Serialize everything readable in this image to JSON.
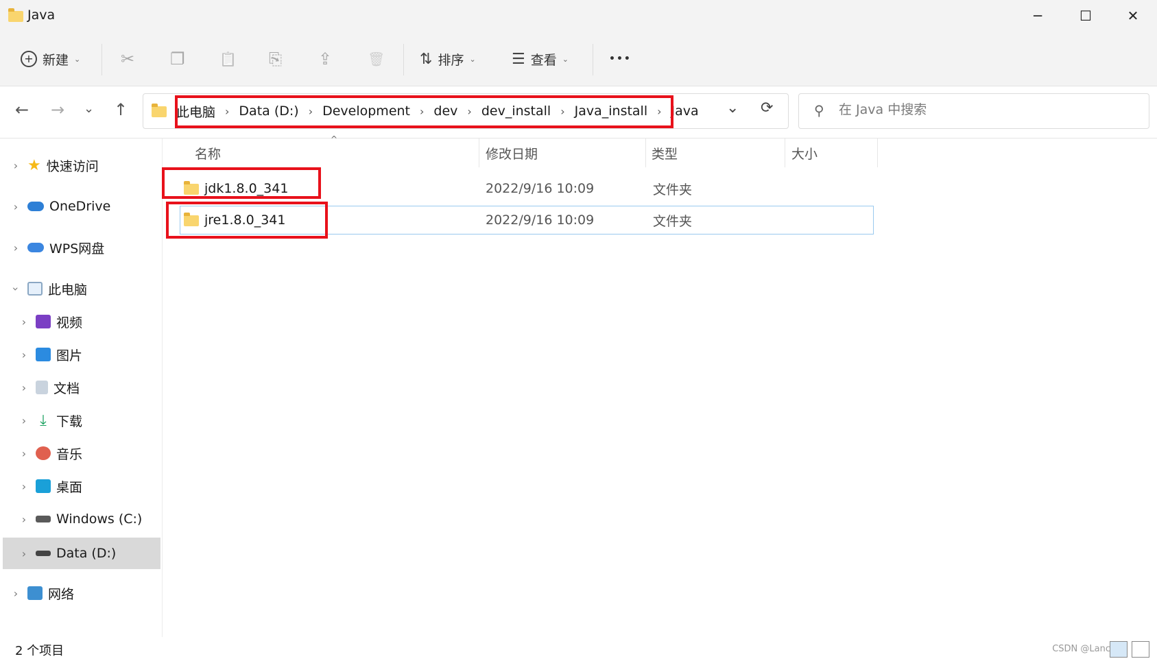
{
  "window": {
    "title": "Java",
    "minimize": "─",
    "maximize": "☐",
    "close": "✕"
  },
  "toolbar": {
    "new_label": "新建",
    "sort_label": "排序",
    "view_label": "查看",
    "more_label": "•••",
    "cut_icon": "✂",
    "copy_icon": "❐",
    "paste_icon": "📋",
    "rename_icon": "⎘",
    "share_icon": "⇪",
    "delete_icon": "🗑"
  },
  "nav": {
    "back": "←",
    "forward": "→",
    "recent": "⌄",
    "up": "↑",
    "refresh": "⟳",
    "dropdown": "⌄"
  },
  "address": {
    "crumbs": [
      "此电脑",
      "Data (D:)",
      "Development",
      "dev",
      "dev_install",
      "Java_install",
      "Java"
    ],
    "separator": "›"
  },
  "search": {
    "placeholder": "在 Java 中搜索"
  },
  "sidebar": {
    "items": [
      {
        "label": "快速访问",
        "icon": "star-icon"
      },
      {
        "label": "OneDrive",
        "icon": "cloud-icon"
      },
      {
        "label": "WPS网盘",
        "icon": "cloud-icon"
      },
      {
        "label": "此电脑",
        "icon": "computer-icon"
      },
      {
        "label": "视频",
        "icon": "video-icon"
      },
      {
        "label": "图片",
        "icon": "picture-icon"
      },
      {
        "label": "文档",
        "icon": "document-icon"
      },
      {
        "label": "下载",
        "icon": "download-icon"
      },
      {
        "label": "音乐",
        "icon": "music-icon"
      },
      {
        "label": "桌面",
        "icon": "desktop-icon"
      },
      {
        "label": "Windows (C:)",
        "icon": "drive-icon"
      },
      {
        "label": "Data (D:)",
        "icon": "drive-icon"
      },
      {
        "label": "网络",
        "icon": "network-icon"
      }
    ]
  },
  "columns": {
    "name": "名称",
    "modified": "修改日期",
    "type": "类型",
    "size": "大小"
  },
  "files": [
    {
      "name": "jdk1.8.0_341",
      "modified": "2022/9/16 10:09",
      "type": "文件夹",
      "size": ""
    },
    {
      "name": "jre1.8.0_341",
      "modified": "2022/9/16 10:09",
      "type": "文件夹",
      "size": ""
    }
  ],
  "status": {
    "count": "2 个项目",
    "watermark": "CSDN @Lance"
  },
  "colors": {
    "highlight": "#e8111b",
    "folder": "#f9d56e",
    "selected_nav": "#d9d9d9"
  }
}
